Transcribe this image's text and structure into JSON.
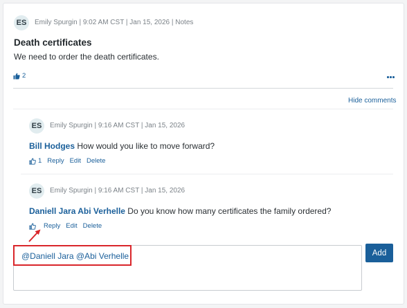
{
  "post": {
    "initials": "ES",
    "meta": "Emily Spurgin | 9:02 AM CST | Jan 15, 2026 | Notes",
    "title": "Death certificates",
    "body": "We need to order the death certificates.",
    "like_count": "2"
  },
  "comments_toggle": "Hide comments",
  "comments": [
    {
      "initials": "ES",
      "meta": "Emily Spurgin | 9:16 AM CST | Jan 15, 2026",
      "mention": "Bill Hodges",
      "text": " How would you like to move forward?",
      "like_count": "1",
      "reply": "Reply",
      "edit": "Edit",
      "delete": "Delete"
    },
    {
      "initials": "ES",
      "meta": "Emily Spurgin | 9:16 AM CST | Jan 15, 2026",
      "mention": "Daniell Jara Abi Verhelle",
      "text": " Do you know how many certificates the family ordered?",
      "like_count": "",
      "reply": "Reply",
      "edit": "Edit",
      "delete": "Delete"
    }
  ],
  "composer": {
    "value": "@Daniell Jara @Abi Verhelle",
    "add_label": "Add"
  },
  "colors": {
    "link": "#1a5f9a",
    "highlight": "#d9252a",
    "avatar_bg": "#e1ecef"
  },
  "icons": {
    "like": "thumbs-up-icon",
    "more": "more-options-icon",
    "annotation": "red-arrow-icon"
  }
}
